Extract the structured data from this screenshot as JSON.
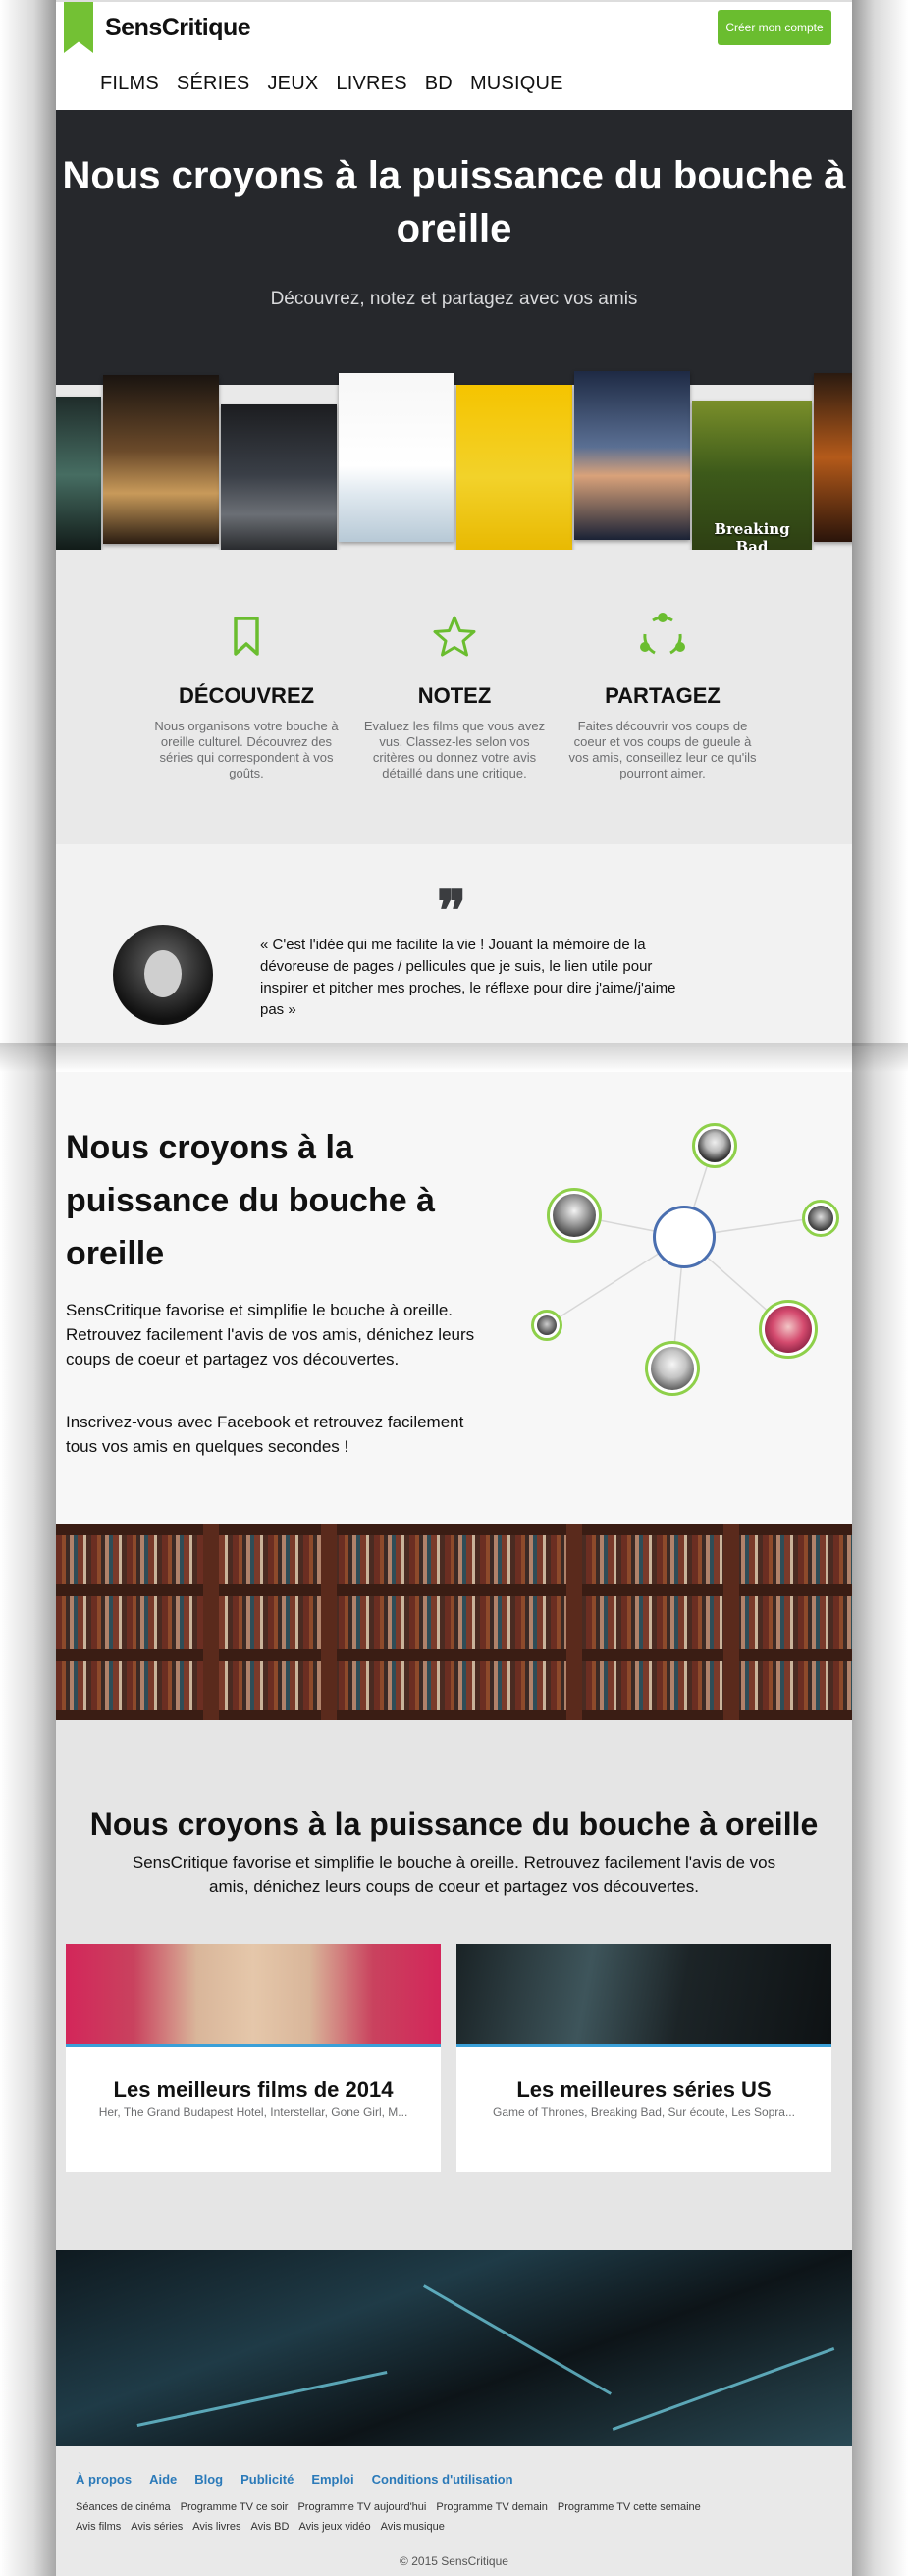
{
  "header": {
    "logo": "SensCritique",
    "signup_label": "Créer mon compte",
    "nav": [
      "FILMS",
      "SÉRIES",
      "JEUX",
      "LIVRES",
      "BD",
      "MUSIQUE"
    ]
  },
  "hero": {
    "title": "Nous croyons à la puissance du bouche à oreille",
    "subtitle": "Découvrez, notez et partagez avec vos amis"
  },
  "posters": [
    {
      "label": ""
    },
    {
      "label": ""
    },
    {
      "label": ""
    },
    {
      "label": ""
    },
    {
      "label": ""
    },
    {
      "label": ""
    },
    {
      "label": "Breaking Bad"
    },
    {
      "label": ""
    }
  ],
  "features": [
    {
      "icon": "bookmark-icon",
      "title": "DÉCOUVREZ",
      "text": "Nous organisons votre bouche à oreille culturel. Découvrez des séries qui correspondent à vos goûts."
    },
    {
      "icon": "star-icon",
      "title": "NOTEZ",
      "text": "Evaluez les films que vous avez vus. Classez-les selon vos critères ou donnez votre avis détaillé dans une critique."
    },
    {
      "icon": "share-icon",
      "title": "PARTAGEZ",
      "text": "Faites découvrir vos coups de coeur et vos coups de gueule à vos amis, conseillez leur ce qu'ils pourront aimer."
    }
  ],
  "testimonial": {
    "quote": "« C'est l'idée qui me facilite la vie ! Jouant la mémoire de la dévoreuse de pages / pellicules que je suis, le lien utile pour inspirer et pitcher mes proches, le réflexe pour dire j'aime/j'aime pas »"
  },
  "intro": {
    "title": "Nous croyons à la puissance du bouche à oreille",
    "p1": "SensCritique favorise et simplifie le bouche à oreille. Retrouvez facilement l'avis de vos amis, dénichez leurs coups de coeur et partagez vos découvertes.",
    "p2": "Inscrivez-vous avec Facebook et retrouvez facilement tous vos amis en quelques secondes !"
  },
  "lists": {
    "title": "Nous croyons à la puissance du bouche à oreille",
    "subtitle": "SensCritique favorise et simplifie le bouche à oreille. Retrouvez facilement l'avis de vos amis, dénichez leurs coups de coeur et partagez vos découvertes.",
    "cards": [
      {
        "title": "Les meilleurs films de 2014",
        "desc": "Her, The Grand Budapest Hotel, Interstellar, Gone Girl, M..."
      },
      {
        "title": "Les meilleures séries US",
        "desc": "Game of Thrones, Breaking Bad, Sur écoute, Les Sopra..."
      }
    ]
  },
  "footer": {
    "links": [
      "À propos",
      "Aide",
      "Blog",
      "Publicité",
      "Emploi",
      "Conditions d'utilisation"
    ],
    "row1": [
      "Séances de cinéma",
      "Programme TV ce soir",
      "Programme TV aujourd'hui",
      "Programme TV demain",
      "Programme TV cette semaine"
    ],
    "row2": [
      "Avis films",
      "Avis séries",
      "Avis livres",
      "Avis BD",
      "Avis jeux vidéo",
      "Avis musique"
    ],
    "copyright": "© 2015 SensCritique"
  },
  "colors": {
    "accent": "#6abd2f",
    "link": "#2b7ab9",
    "hero_bg": "#26282c"
  }
}
